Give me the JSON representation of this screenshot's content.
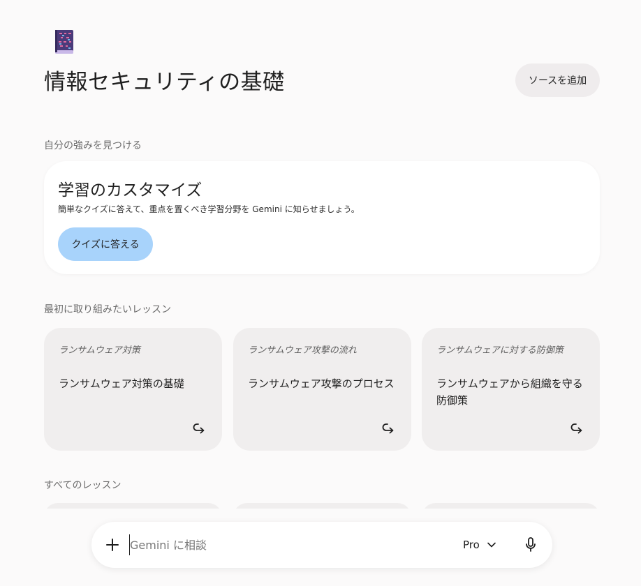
{
  "header": {
    "icon": "book-icon",
    "title": "情報セキュリティの基礎",
    "add_source_label": "ソースを追加"
  },
  "strengths": {
    "section_label": "自分の強みを見つける",
    "card_title": "学習のカスタマイズ",
    "card_description": "簡単なクイズに答えて、重点を置くべき学習分野を Gemini に知らせましょう。",
    "quiz_button_label": "クイズに答える"
  },
  "recommended": {
    "section_label": "最初に取り組みたいレッスン",
    "lessons": [
      {
        "tag": "ランサムウェア対策",
        "title": "ランサムウェア対策の基礎"
      },
      {
        "tag": "ランサムウェア攻撃の流れ",
        "title": "ランサムウェア攻撃のプロセス"
      },
      {
        "tag": "ランサムウェアに対する防御策",
        "title": "ランサムウェアから組織を守る防御策"
      }
    ]
  },
  "all_lessons": {
    "section_label": "すべてのレッスン"
  },
  "chat": {
    "placeholder": "Gemini に相談",
    "model_label": "Pro"
  },
  "colors": {
    "background": "#fbfafa",
    "card": "#ffffff",
    "lesson_card": "#f0eeee",
    "quiz_button": "#a8d3fb",
    "pill_button": "#efeced"
  }
}
